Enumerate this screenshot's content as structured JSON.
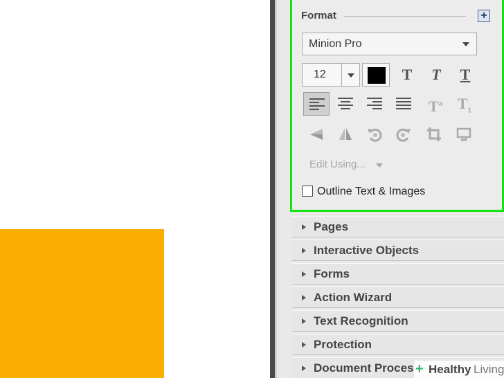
{
  "format_panel": {
    "title": "Format",
    "expand_symbol": "+",
    "font_family": "Minion Pro",
    "font_size": "12",
    "text_color": "#000000",
    "style_buttons": {
      "bold": "T",
      "italic": "T",
      "underline": "T",
      "superscript": "T",
      "superscript_mark": "a",
      "subscript": "T",
      "subscript_mark": "1"
    },
    "edit_using_label": "Edit Using...",
    "outline_label": "Outline Text & Images"
  },
  "sections": [
    {
      "label": "Pages"
    },
    {
      "label": "Interactive Objects"
    },
    {
      "label": "Forms"
    },
    {
      "label": "Action Wizard"
    },
    {
      "label": "Text Recognition"
    },
    {
      "label": "Protection"
    },
    {
      "label": "Document Proces"
    }
  ],
  "watermark": {
    "brand": "Healthy",
    "suffix": "Living",
    "cross": "+"
  },
  "colors": {
    "highlight_border": "#12e312",
    "canvas_shape": "#f9ae00",
    "watermark_cross": "#2bb673"
  }
}
